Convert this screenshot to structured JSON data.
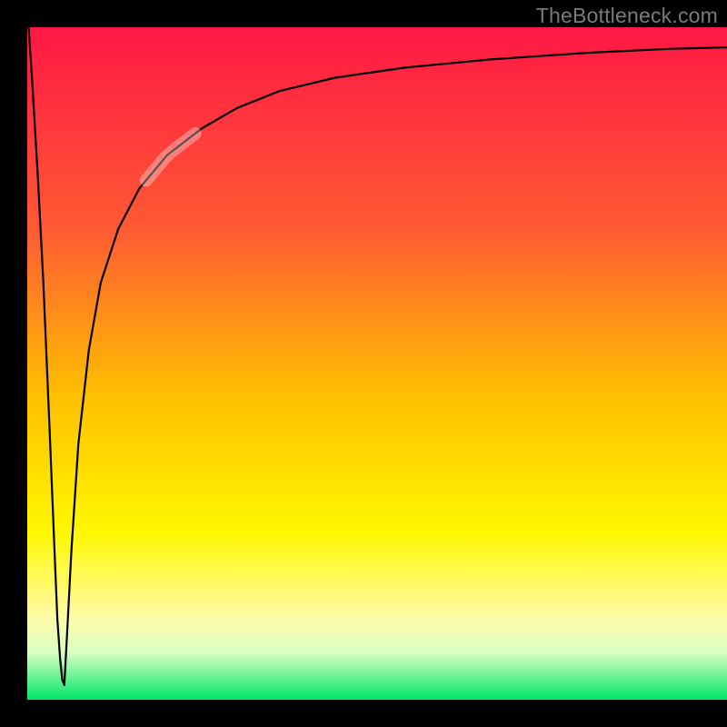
{
  "watermark": "TheBottleneck.com",
  "chart_data": {
    "type": "line",
    "title": "",
    "xlabel": "",
    "ylabel": "",
    "xlim": [
      0,
      100
    ],
    "ylim": [
      0,
      100
    ],
    "grid": false,
    "legend": false,
    "background_gradient_stops": [
      {
        "pos": 0.0,
        "color": "#ff1745"
      },
      {
        "pos": 0.3,
        "color": "#ff5a33"
      },
      {
        "pos": 0.55,
        "color": "#ffc000"
      },
      {
        "pos": 0.75,
        "color": "#fff700"
      },
      {
        "pos": 0.88,
        "color": "#fffbaa"
      },
      {
        "pos": 0.93,
        "color": "#d8ffc4"
      },
      {
        "pos": 1.0,
        "color": "#00e66a"
      }
    ],
    "series": [
      {
        "name": "left-spike",
        "x": [
          0.2,
          0.7,
          1.5,
          2.3,
          3.2,
          3.9,
          4.3,
          4.7,
          5.0,
          5.3
        ],
        "y": [
          100,
          92,
          78,
          62,
          40,
          22,
          12,
          6,
          3,
          2.2
        ]
      },
      {
        "name": "main-curve",
        "x": [
          5.3,
          5.7,
          6.3,
          7.3,
          8.8,
          10.5,
          13,
          16,
          20,
          25,
          30,
          36,
          44,
          54,
          66,
          80,
          92,
          100
        ],
        "y": [
          2.2,
          10,
          22,
          38,
          52,
          62,
          70,
          76,
          81,
          85,
          88,
          90.5,
          92.5,
          94,
          95.2,
          96.2,
          96.8,
          97
        ]
      }
    ],
    "highlight_segment": {
      "series": "main-curve",
      "x_range": [
        17,
        24
      ],
      "note": "thick translucent pale overlay on curve"
    }
  }
}
